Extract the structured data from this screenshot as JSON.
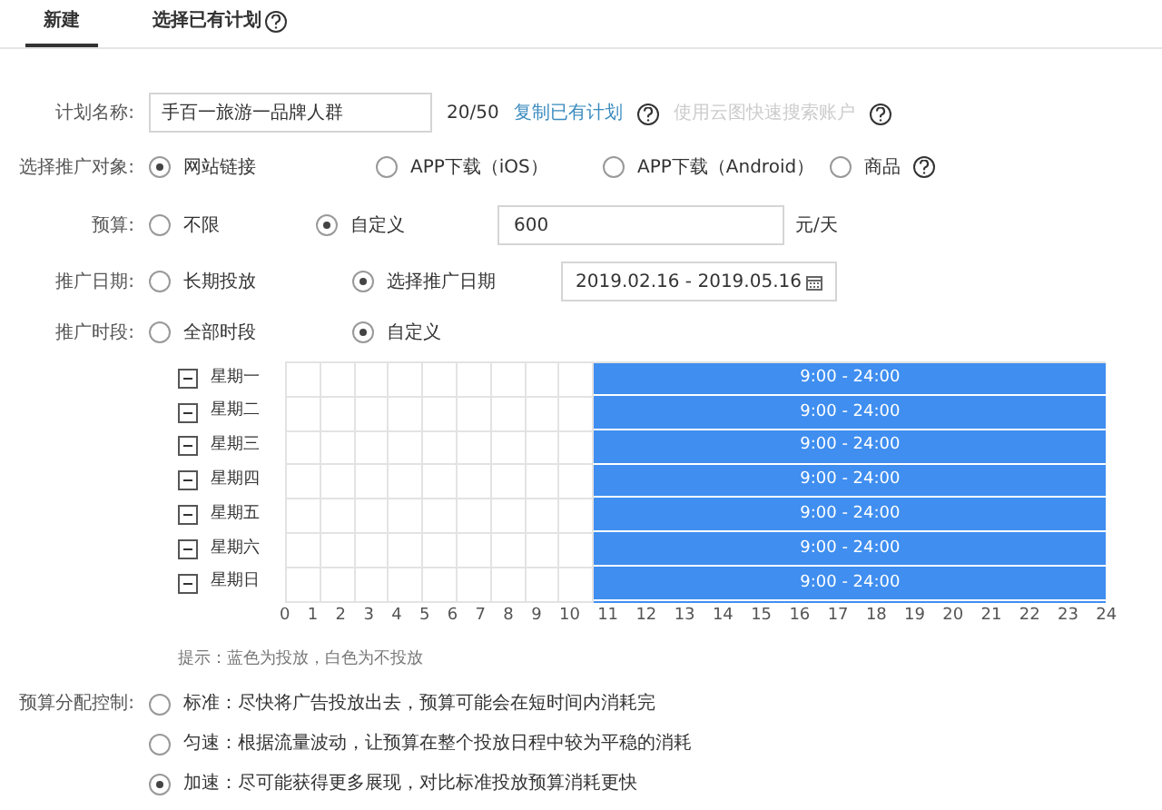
{
  "tabs": [
    {
      "label": "新建",
      "selected": true,
      "help": false
    },
    {
      "label": "选择已有计划",
      "selected": false,
      "help": true
    }
  ],
  "plan_name": {
    "label": "计划名称:",
    "value": "手百一旅游一品牌人群",
    "count": "20/50",
    "copy_link": "复制已有计划",
    "disabled_link": "使用云图快速搜索账户"
  },
  "target": {
    "label": "选择推广对象:",
    "options": [
      {
        "label": "网站链接",
        "selected": true,
        "help": false
      },
      {
        "label": "APP下载（iOS）",
        "selected": false,
        "help": false
      },
      {
        "label": "APP下载（Android）",
        "selected": false,
        "help": false
      },
      {
        "label": "商品",
        "selected": false,
        "help": true
      }
    ]
  },
  "budget": {
    "label": "预算:",
    "options": [
      {
        "label": "不限",
        "selected": false
      },
      {
        "label": "自定义",
        "selected": true
      }
    ],
    "value": "600",
    "unit": "元/天"
  },
  "date": {
    "label": "推广日期:",
    "options": [
      {
        "label": "长期投放",
        "selected": false
      },
      {
        "label": "选择推广日期",
        "selected": true
      }
    ],
    "value": "2019.02.16 - 2019.05.16"
  },
  "time": {
    "label": "推广时段:",
    "options": [
      {
        "label": "全部时段",
        "selected": false
      },
      {
        "label": "自定义",
        "selected": true
      }
    ]
  },
  "schedule": {
    "rows": [
      {
        "day": "星期一",
        "range": "9:00 - 24:00",
        "hours": [
          false,
          false,
          false,
          false,
          false,
          false,
          false,
          false,
          false,
          true,
          true,
          true,
          true,
          true,
          true,
          true,
          true,
          true,
          true,
          true,
          true,
          true,
          true,
          true
        ]
      },
      {
        "day": "星期二",
        "range": "9:00 - 24:00",
        "hours": [
          false,
          false,
          false,
          false,
          false,
          false,
          false,
          false,
          false,
          true,
          true,
          true,
          true,
          true,
          true,
          true,
          true,
          true,
          true,
          true,
          true,
          true,
          true,
          true
        ]
      },
      {
        "day": "星期三",
        "range": "9:00 - 24:00",
        "hours": [
          false,
          false,
          false,
          false,
          false,
          false,
          false,
          false,
          false,
          true,
          true,
          true,
          true,
          true,
          true,
          true,
          true,
          true,
          true,
          true,
          true,
          true,
          true,
          true
        ]
      },
      {
        "day": "星期四",
        "range": "9:00 - 24:00",
        "hours": [
          false,
          false,
          false,
          false,
          false,
          false,
          false,
          false,
          false,
          true,
          true,
          true,
          true,
          true,
          true,
          true,
          true,
          true,
          true,
          true,
          true,
          true,
          true,
          true
        ]
      },
      {
        "day": "星期五",
        "range": "9:00 - 24:00",
        "hours": [
          false,
          false,
          false,
          false,
          false,
          false,
          false,
          false,
          false,
          true,
          true,
          true,
          true,
          true,
          true,
          true,
          true,
          true,
          true,
          true,
          true,
          true,
          true,
          true
        ]
      },
      {
        "day": "星期六",
        "range": "9:00 - 24:00",
        "hours": [
          false,
          false,
          false,
          false,
          false,
          false,
          false,
          false,
          false,
          true,
          true,
          true,
          true,
          true,
          true,
          true,
          true,
          true,
          true,
          true,
          true,
          true,
          true,
          true
        ]
      },
      {
        "day": "星期日",
        "range": "9:00 - 24:00",
        "hours": [
          false,
          false,
          false,
          false,
          false,
          false,
          false,
          false,
          false,
          true,
          true,
          true,
          true,
          true,
          true,
          true,
          true,
          true,
          true,
          true,
          true,
          true,
          true,
          true
        ]
      }
    ],
    "axis": "0 1 2 3 4 5 6 7 8 9 10 11 12 13 14 15 16 17 18 19 20 21 22 23 24",
    "hint": "提示：蓝色为投放，白色为不投放"
  },
  "pacing": {
    "label": "预算分配控制:",
    "options": [
      {
        "label": "标准：尽快将广告投放出去，预算可能会在短时间内消耗完",
        "selected": false
      },
      {
        "label": "匀速：根据流量波动，让预算在整个投放日程中较为平稳的消耗",
        "selected": false
      },
      {
        "label": "加速：尽可能获得更多展现，对比标准投放预算消耗更快",
        "selected": true
      }
    ]
  }
}
